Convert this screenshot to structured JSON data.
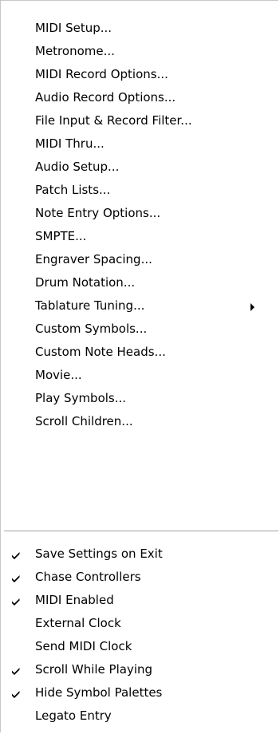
{
  "menu": {
    "items": [
      {
        "label": "MIDI Setup...",
        "checked": false,
        "submenu": false
      },
      {
        "label": "Metronome...",
        "checked": false,
        "submenu": false
      },
      {
        "label": "MIDI Record Options...",
        "checked": false,
        "submenu": false
      },
      {
        "label": "Audio Record Options...",
        "checked": false,
        "submenu": false
      },
      {
        "label": "File Input & Record Filter...",
        "checked": false,
        "submenu": false
      },
      {
        "label": "MIDI Thru...",
        "checked": false,
        "submenu": false
      },
      {
        "label": "Audio Setup...",
        "checked": false,
        "submenu": false
      },
      {
        "label": "Patch Lists...",
        "checked": false,
        "submenu": false
      },
      {
        "label": "Note Entry Options...",
        "checked": false,
        "submenu": false
      },
      {
        "label": "SMPTE...",
        "checked": false,
        "submenu": false
      },
      {
        "label": "Engraver Spacing...",
        "checked": false,
        "submenu": false
      },
      {
        "label": "Drum Notation...",
        "checked": false,
        "submenu": false
      },
      {
        "label": "Tablature Tuning...",
        "checked": false,
        "submenu": true
      },
      {
        "label": "Custom Symbols...",
        "checked": false,
        "submenu": false
      },
      {
        "label": "Custom Note Heads...",
        "checked": false,
        "submenu": false
      },
      {
        "label": "Movie...",
        "checked": false,
        "submenu": false
      },
      {
        "label": "Play Symbols...",
        "checked": false,
        "submenu": false
      },
      {
        "label": "Scroll Children...",
        "checked": false,
        "submenu": false
      }
    ],
    "toggles": [
      {
        "label": "Save Settings on Exit",
        "checked": true
      },
      {
        "label": "Chase Controllers",
        "checked": true
      },
      {
        "label": "MIDI Enabled",
        "checked": true
      },
      {
        "label": "External Clock",
        "checked": false
      },
      {
        "label": "Send MIDI Clock",
        "checked": false
      },
      {
        "label": "Scroll While Playing",
        "checked": true
      },
      {
        "label": "Hide Symbol Palettes",
        "checked": true
      },
      {
        "label": "Legato Entry",
        "checked": false
      }
    ]
  }
}
